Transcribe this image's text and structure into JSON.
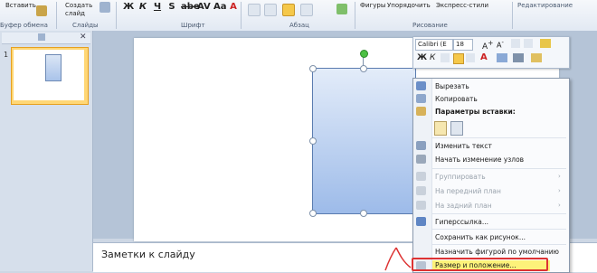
{
  "ribbon": {
    "paste_label": "Вставить",
    "create_slide_label": "Создать слайд",
    "group_clipboard": "Буфер обмена",
    "group_slides": "Слайды",
    "group_font": "Шрифт",
    "group_paragraph": "Абзац",
    "group_drawing": "Рисование",
    "group_editing": "Редактирование",
    "shapes_label": "Фигуры",
    "arrange_label": "Упорядочить",
    "quick_styles_label": "Экспресс-стили"
  },
  "mini_toolbar": {
    "font_name": "Calibri (Е",
    "font_size": "18"
  },
  "slides_pane": {
    "slide_number": "1"
  },
  "notes": {
    "placeholder": "Заметки к слайду"
  },
  "context_menu": {
    "items": [
      {
        "label": "Вырезать",
        "enabled": true
      },
      {
        "label": "Копировать",
        "enabled": true
      },
      {
        "label": "Параметры вставки:",
        "enabled": true
      },
      {
        "label": "Изменить текст",
        "enabled": true
      },
      {
        "label": "Начать изменение узлов",
        "enabled": true
      },
      {
        "label": "Группировать",
        "enabled": false
      },
      {
        "label": "На передний план",
        "enabled": false
      },
      {
        "label": "На задний план",
        "enabled": false
      },
      {
        "label": "Гиперссылка...",
        "enabled": true
      },
      {
        "label": "Сохранить как рисунок...",
        "enabled": true
      },
      {
        "label": "Назначить фигурой по умолчанию",
        "enabled": true
      },
      {
        "label": "Размер и положение...",
        "enabled": true
      }
    ]
  },
  "colors": {
    "highlight": "#fdf27a",
    "annotation": "#dd3333",
    "font_color_red": "#cc2222"
  }
}
